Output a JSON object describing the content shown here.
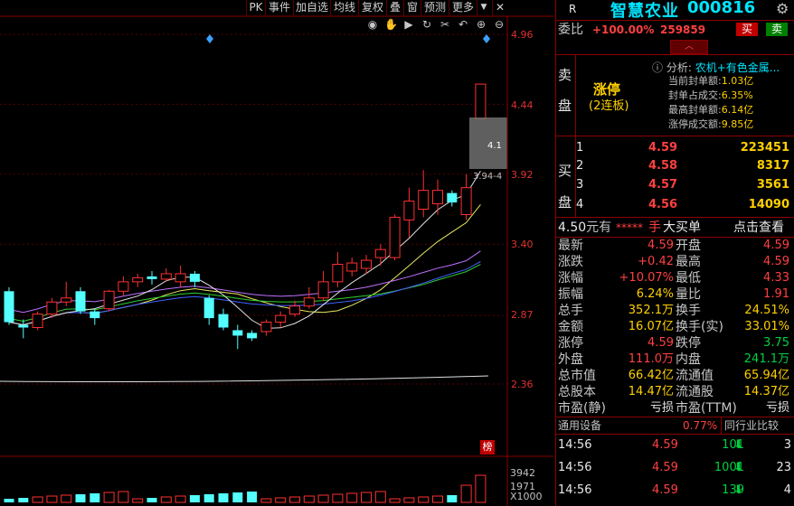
{
  "toolbar": {
    "items": [
      "PK",
      "事件",
      "加自选",
      "均线",
      "复权",
      "叠",
      "窗",
      "预测",
      "更多"
    ],
    "close_icon": "close-icon"
  },
  "chart_toolbar_icons": [
    "eye-icon",
    "hand-icon",
    "play-icon",
    "refresh-icon",
    "scissors-icon",
    "undo-icon",
    "zoom-in-icon",
    "zoom-out-icon"
  ],
  "chart_data": {
    "type": "candlestick",
    "y_ticks": [
      "4.96",
      "4.44",
      "3.92",
      "3.40",
      "2.87",
      "2.36"
    ],
    "ylim": [
      2.1,
      5.1
    ],
    "candles": [
      {
        "o": 3.05,
        "c": 2.82,
        "h": 3.08,
        "l": 2.8
      },
      {
        "o": 2.8,
        "c": 2.78,
        "h": 2.84,
        "l": 2.7
      },
      {
        "o": 2.78,
        "c": 2.88,
        "h": 2.9,
        "l": 2.76
      },
      {
        "o": 2.88,
        "c": 2.97,
        "h": 3.0,
        "l": 2.85
      },
      {
        "o": 2.97,
        "c": 3.0,
        "h": 3.12,
        "l": 2.94
      },
      {
        "o": 3.05,
        "c": 2.9,
        "h": 3.08,
        "l": 2.88
      },
      {
        "o": 2.9,
        "c": 2.85,
        "h": 2.92,
        "l": 2.8
      },
      {
        "o": 2.92,
        "c": 3.05,
        "h": 3.06,
        "l": 2.9
      },
      {
        "o": 3.05,
        "c": 3.12,
        "h": 3.16,
        "l": 3.02
      },
      {
        "o": 3.12,
        "c": 3.15,
        "h": 3.18,
        "l": 3.08
      },
      {
        "o": 3.16,
        "c": 3.14,
        "h": 3.2,
        "l": 3.1
      },
      {
        "o": 3.14,
        "c": 3.18,
        "h": 3.22,
        "l": 3.12
      },
      {
        "o": 3.12,
        "c": 3.18,
        "h": 3.24,
        "l": 3.08
      },
      {
        "o": 3.18,
        "c": 3.12,
        "h": 3.2,
        "l": 3.08
      },
      {
        "o": 3.0,
        "c": 2.85,
        "h": 3.02,
        "l": 2.8
      },
      {
        "o": 2.88,
        "c": 2.78,
        "h": 2.92,
        "l": 2.76
      },
      {
        "o": 2.76,
        "c": 2.72,
        "h": 2.8,
        "l": 2.62
      },
      {
        "o": 2.74,
        "c": 2.7,
        "h": 2.76,
        "l": 2.68
      },
      {
        "o": 2.75,
        "c": 2.82,
        "h": 2.84,
        "l": 2.72
      },
      {
        "o": 2.82,
        "c": 2.87,
        "h": 2.9,
        "l": 2.78
      },
      {
        "o": 2.88,
        "c": 2.94,
        "h": 2.98,
        "l": 2.86
      },
      {
        "o": 2.94,
        "c": 3.0,
        "h": 3.08,
        "l": 2.92
      },
      {
        "o": 3.0,
        "c": 3.12,
        "h": 3.2,
        "l": 2.98
      },
      {
        "o": 3.12,
        "c": 3.25,
        "h": 3.34,
        "l": 3.08
      },
      {
        "o": 3.2,
        "c": 3.26,
        "h": 3.3,
        "l": 3.16
      },
      {
        "o": 3.22,
        "c": 3.28,
        "h": 3.32,
        "l": 3.18
      },
      {
        "o": 3.3,
        "c": 3.36,
        "h": 3.4,
        "l": 3.24
      },
      {
        "o": 3.3,
        "c": 3.6,
        "h": 3.62,
        "l": 3.28
      },
      {
        "o": 3.58,
        "c": 3.72,
        "h": 3.82,
        "l": 3.45
      },
      {
        "o": 3.66,
        "c": 3.8,
        "h": 3.95,
        "l": 3.6
      },
      {
        "o": 3.7,
        "c": 3.8,
        "h": 3.88,
        "l": 3.62
      },
      {
        "o": 3.78,
        "c": 3.71,
        "h": 3.8,
        "l": 3.68
      },
      {
        "o": 3.62,
        "c": 3.82,
        "h": 3.92,
        "l": 3.58
      },
      {
        "o": 4.33,
        "c": 4.59,
        "h": 4.59,
        "l": 4.33
      }
    ],
    "volume_ticks": [
      "3942",
      "1971",
      "X1000"
    ]
  },
  "chart_labels": {
    "price_marker": "4.1",
    "range_marker": "3.94-4",
    "rank_badge": "榜"
  },
  "header": {
    "r_label": "R",
    "stock_name": "智慧农业",
    "stock_code": "000816",
    "gear_icon": "gear-icon"
  },
  "weibi": {
    "label": "委比",
    "pct": "+100.00%",
    "amount": "259859",
    "buy_btn": "买",
    "sell_btn": "卖"
  },
  "sell_side": {
    "label_top": "卖",
    "label_bottom": "盘",
    "limit_up": "涨停",
    "streak": "(2连板)",
    "analysis_label": "分析:",
    "analysis_value": "农机+有色金属...",
    "info": [
      {
        "k": "当前封单额:",
        "v": "1.03亿"
      },
      {
        "k": "封单占成交:",
        "v": "6.35%"
      },
      {
        "k": "最高封单额:",
        "v": "6.14亿"
      },
      {
        "k": "涨停成交额:",
        "v": "9.85亿"
      }
    ]
  },
  "buy_side": {
    "label_top": "买",
    "label_bottom": "盘",
    "rows": [
      {
        "level": "1",
        "price": "4.59",
        "vol": "223451"
      },
      {
        "level": "2",
        "price": "4.58",
        "vol": "8317"
      },
      {
        "level": "3",
        "price": "4.57",
        "vol": "3561"
      },
      {
        "level": "4",
        "price": "4.56",
        "vol": "14090"
      }
    ]
  },
  "big_order": {
    "price": "4.50",
    "unit": "元有",
    "stars": "*****",
    "hand": "手",
    "label": "大买单",
    "link": "点击查看"
  },
  "quote": [
    {
      "k1": "最新",
      "v1": "4.59",
      "c1": "red",
      "k2": "开盘",
      "v2": "4.59",
      "c2": "red"
    },
    {
      "k1": "涨跌",
      "v1": "+0.42",
      "c1": "red",
      "k2": "最高",
      "v2": "4.59",
      "c2": "red"
    },
    {
      "k1": "涨幅",
      "v1": "+10.07%",
      "c1": "red",
      "k2": "最低",
      "v2": "4.33",
      "c2": "red"
    },
    {
      "k1": "振幅",
      "v1": "6.24%",
      "c1": "yellow",
      "k2": "量比",
      "v2": "1.91",
      "c2": "red"
    },
    {
      "k1": "总手",
      "v1": "352.1万",
      "c1": "yellow",
      "k2": "换手",
      "v2": "24.51%",
      "c2": "yellow"
    },
    {
      "k1": "金额",
      "v1": "16.07亿",
      "c1": "yellow",
      "k2": "换手(实)",
      "v2": "33.01%",
      "c2": "yellow"
    },
    {
      "k1": "涨停",
      "v1": "4.59",
      "c1": "red",
      "k2": "跌停",
      "v2": "3.75",
      "c2": "green"
    },
    {
      "k1": "外盘",
      "v1": "111.0万",
      "c1": "red",
      "k2": "内盘",
      "v2": "241.1万",
      "c2": "green"
    },
    {
      "k1": "总市值",
      "v1": "66.42亿",
      "c1": "yellow",
      "k2": "流通值",
      "v2": "65.94亿",
      "c2": "yellow"
    },
    {
      "k1": "总股本",
      "v1": "14.47亿",
      "c1": "yellow",
      "k2": "流通股",
      "v2": "14.37亿",
      "c2": "yellow"
    },
    {
      "k1": "市盈(静)",
      "v1": "亏损",
      "c1": "white",
      "k2": "市盈(TTM)",
      "v2": "亏损",
      "c2": "white"
    }
  ],
  "industry": {
    "name": "通用设备",
    "pct": "0.77%",
    "compare": "同行业比较"
  },
  "ticks": [
    {
      "time": "14:56",
      "price": "4.59",
      "vol": "101",
      "count": "3"
    },
    {
      "time": "14:56",
      "price": "4.59",
      "vol": "1001",
      "count": "23"
    },
    {
      "time": "14:56",
      "price": "4.59",
      "vol": "139",
      "count": "4"
    }
  ]
}
